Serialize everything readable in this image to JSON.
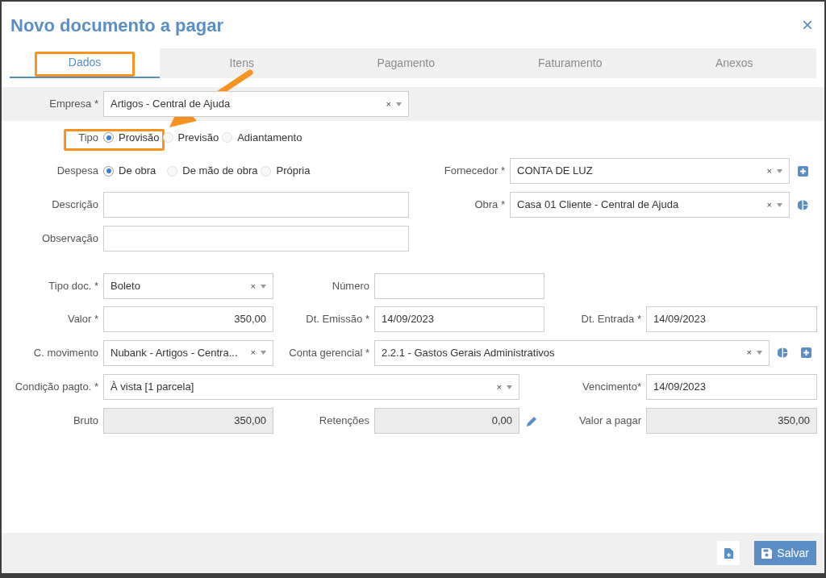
{
  "dialog": {
    "title": "Novo documento a pagar",
    "close": "×"
  },
  "tabs": [
    {
      "label": "Dados",
      "selected": true
    },
    {
      "label": "Itens",
      "selected": false
    },
    {
      "label": "Pagamento",
      "selected": false
    },
    {
      "label": "Faturamento",
      "selected": false
    },
    {
      "label": "Anexos",
      "selected": false
    }
  ],
  "rows": [
    [
      {
        "kind": "select",
        "label": "Empresa *",
        "value": "Artigos - Central de Ajuda",
        "clear": "×"
      }
    ],
    [
      {
        "kind": "radio",
        "label": "Tipo",
        "options": [
          {
            "label": "Provisão",
            "selected": true
          },
          {
            "label": "Previsão",
            "selected": false
          },
          {
            "label": "Adiantamento",
            "selected": false
          }
        ]
      }
    ],
    [
      {
        "kind": "radio",
        "label": "Despesa",
        "options": [
          {
            "label": "De obra",
            "selected": true
          },
          {
            "label": "De mão de obra",
            "selected": false
          },
          {
            "label": "Própria",
            "selected": false
          }
        ]
      },
      {
        "kind": "select",
        "label": "Fornecedor *",
        "value": "CONTA DE LUZ",
        "clear": "×",
        "actions": [
          {
            "kind": "add"
          }
        ]
      }
    ],
    [
      {
        "kind": "text",
        "label": "Descrição"
      },
      {
        "kind": "select",
        "label": "Obra *",
        "value": "Casa 01 Cliente - Central de Ajuda",
        "clear": "×",
        "actions": [
          {
            "kind": "chart"
          }
        ]
      }
    ],
    [
      {
        "kind": "text",
        "label": "Observação"
      }
    ],
    [
      {
        "kind": "select",
        "label": "Tipo doc. *",
        "value": "Boleto",
        "clear": "×"
      },
      {
        "kind": "text",
        "label": "Número"
      }
    ],
    [
      {
        "kind": "amount",
        "label": "Valor *",
        "value": "350,00"
      },
      {
        "kind": "text",
        "label": "Dt. Emissão *",
        "value": "14/09/2023"
      },
      {
        "kind": "text",
        "label": "Dt. Entrada *",
        "value": "14/09/2023"
      }
    ],
    [
      {
        "kind": "select",
        "label": "C. movimento",
        "value": "Nubank - Artigos - Centra...",
        "clear": "×"
      },
      {
        "kind": "select",
        "label": "Conta gerencial *",
        "value": "2.2.1 - Gastos Gerais Administrativos",
        "clear": "×",
        "actions": [
          {
            "kind": "chart"
          },
          {
            "kind": "add"
          }
        ]
      }
    ],
    [
      {
        "kind": "select",
        "label": "Condição pagto. *",
        "value": "À vista [1 parcela]",
        "clear": "×"
      },
      {
        "kind": "text",
        "label": "Vencimento*",
        "value": "14/09/2023"
      }
    ],
    [
      {
        "kind": "readonly",
        "label": "Bruto",
        "value": "350,00"
      },
      {
        "kind": "readonly",
        "label": "Retenções",
        "value": "0,00",
        "actions": [
          {
            "kind": "edit"
          }
        ]
      },
      {
        "kind": "readonly",
        "label": "Valor a pagar",
        "value": "350,00"
      }
    ]
  ],
  "footer": {
    "save": "Salvar"
  }
}
